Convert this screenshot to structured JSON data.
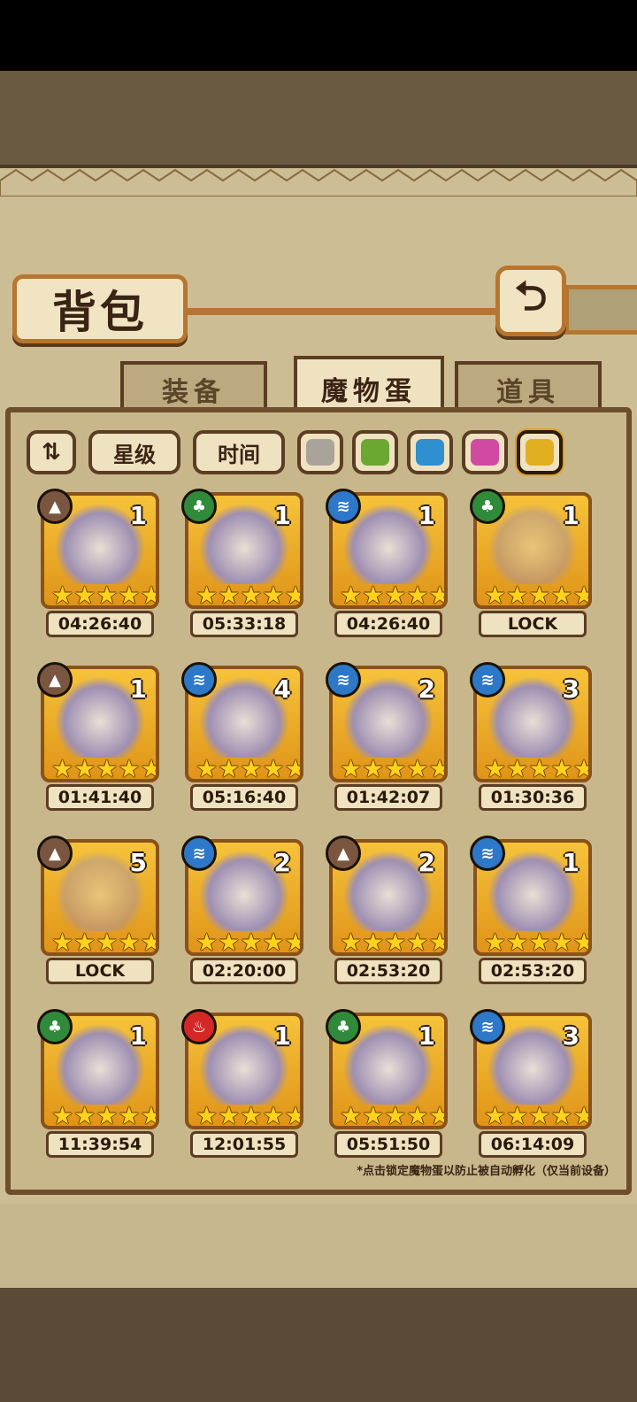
{
  "header": {
    "title": "背包",
    "back_icon": "return-arrow-icon"
  },
  "tabs": [
    {
      "label": "装备",
      "active": false
    },
    {
      "label": "魔物蛋",
      "active": true
    },
    {
      "label": "道具",
      "active": false
    }
  ],
  "filters": {
    "sort_icon": "sort-toggle-icon",
    "star_label": "星级",
    "time_label": "时间",
    "rarity_colors": [
      "#a9a39a",
      "#6aa832",
      "#2f8fcf",
      "#d04aa4",
      "#e0b020"
    ],
    "selected_rarity": 4
  },
  "element_colors": {
    "earth": "#7a5640",
    "grass": "#2f8a3a",
    "water": "#2d78c8",
    "fire": "#d42828"
  },
  "element_glyphs": {
    "earth": "▲",
    "grass": "♣",
    "water": "≋",
    "fire": "♨"
  },
  "eggs": [
    {
      "element": "earth",
      "count": "1",
      "stars": 5,
      "timer": "04:26:40",
      "locked": false
    },
    {
      "element": "grass",
      "count": "1",
      "stars": 5,
      "timer": "05:33:18",
      "locked": false
    },
    {
      "element": "water",
      "count": "1",
      "stars": 5,
      "timer": "04:26:40",
      "locked": false
    },
    {
      "element": "grass",
      "count": "1",
      "stars": 5,
      "timer": "LOCK",
      "locked": true
    },
    {
      "element": "earth",
      "count": "1",
      "stars": 5,
      "timer": "01:41:40",
      "locked": false
    },
    {
      "element": "water",
      "count": "4",
      "stars": 5,
      "timer": "05:16:40",
      "locked": false
    },
    {
      "element": "water",
      "count": "2",
      "stars": 5,
      "timer": "01:42:07",
      "locked": false
    },
    {
      "element": "water",
      "count": "3",
      "stars": 5,
      "timer": "01:30:36",
      "locked": false
    },
    {
      "element": "earth",
      "count": "5",
      "stars": 5,
      "timer": "LOCK",
      "locked": true
    },
    {
      "element": "water",
      "count": "2",
      "stars": 5,
      "timer": "02:20:00",
      "locked": false
    },
    {
      "element": "earth",
      "count": "2",
      "stars": 5,
      "timer": "02:53:20",
      "locked": false
    },
    {
      "element": "water",
      "count": "1",
      "stars": 5,
      "timer": "02:53:20",
      "locked": false
    },
    {
      "element": "grass",
      "count": "1",
      "stars": 5,
      "timer": "11:39:54",
      "locked": false
    },
    {
      "element": "fire",
      "count": "1",
      "stars": 5,
      "timer": "12:01:55",
      "locked": false
    },
    {
      "element": "grass",
      "count": "1",
      "stars": 5,
      "timer": "05:51:50",
      "locked": false
    },
    {
      "element": "water",
      "count": "3",
      "stars": 5,
      "timer": "06:14:09",
      "locked": false
    }
  ],
  "footer_note": "*点击锁定魔物蛋以防止被自动孵化（仅当前设备）"
}
